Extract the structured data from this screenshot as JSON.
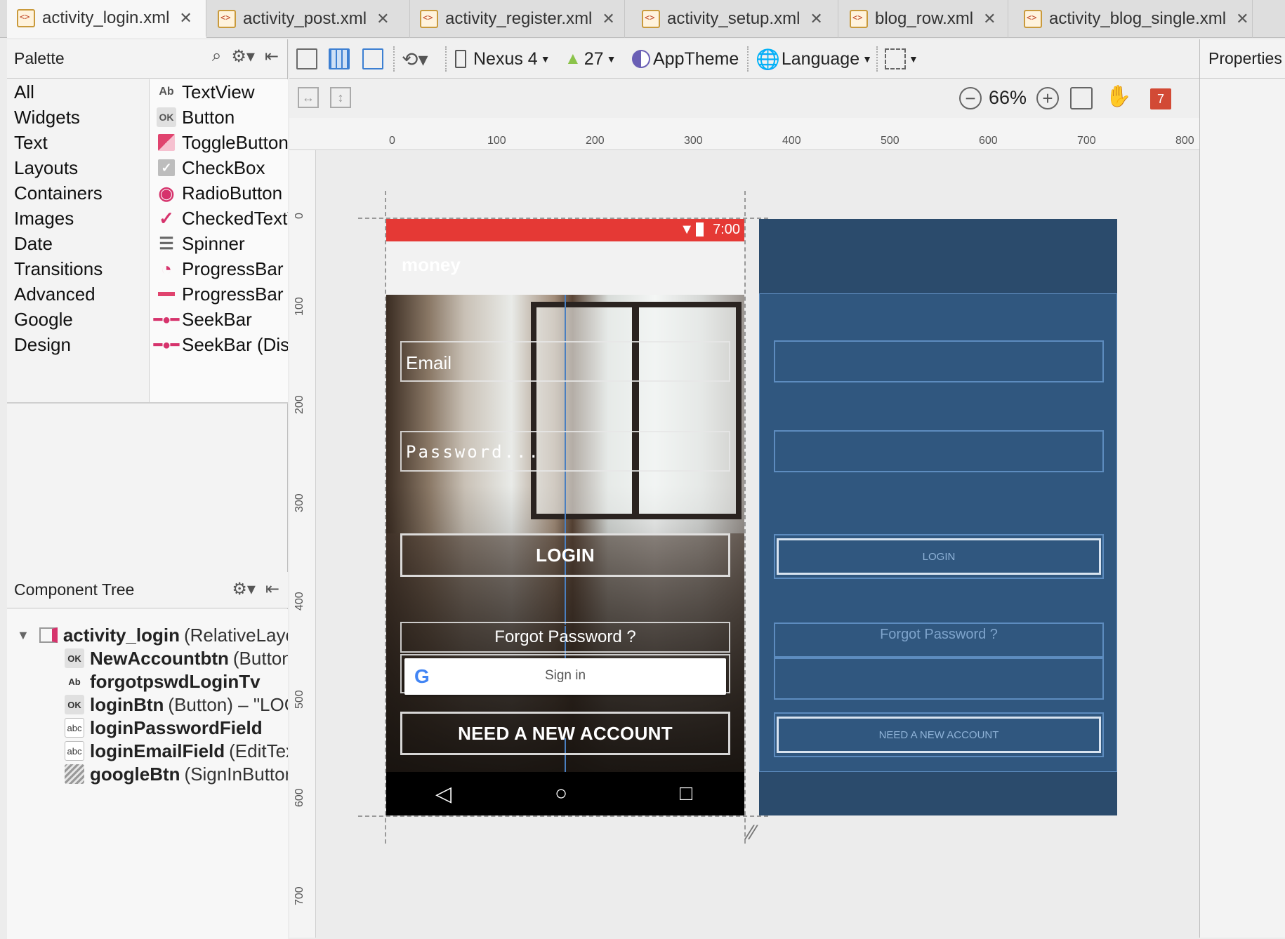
{
  "tabs": [
    {
      "label": "activity_login.xml",
      "active": true
    },
    {
      "label": "activity_post.xml",
      "active": false
    },
    {
      "label": "activity_register.xml",
      "active": false
    },
    {
      "label": "activity_setup.xml",
      "active": false
    },
    {
      "label": "blog_row.xml",
      "active": false
    },
    {
      "label": "activity_blog_single.xml",
      "active": false
    }
  ],
  "palette": {
    "title": "Palette",
    "categories": [
      "All",
      "Widgets",
      "Text",
      "Layouts",
      "Containers",
      "Images",
      "Date",
      "Transitions",
      "Advanced",
      "Google",
      "Design"
    ],
    "widgets": [
      {
        "icon": "Ab",
        "label": "TextView"
      },
      {
        "icon": "OK",
        "label": "Button"
      },
      {
        "icon": "toggle-icon",
        "label": "ToggleButton"
      },
      {
        "icon": "checkbox-icon",
        "label": "CheckBox"
      },
      {
        "icon": "radio-icon",
        "label": "RadioButton"
      },
      {
        "icon": "checked-text-icon",
        "label": "CheckedTextView"
      },
      {
        "icon": "spinner-icon",
        "label": "Spinner"
      },
      {
        "icon": "progress-circle-icon",
        "label": "ProgressBar"
      },
      {
        "icon": "progress-bar-icon",
        "label": "ProgressBar"
      },
      {
        "icon": "seekbar-icon",
        "label": "SeekBar"
      },
      {
        "icon": "seekbar-icon",
        "label": "SeekBar (Discrete)"
      }
    ]
  },
  "component_tree": {
    "title": "Component Tree",
    "nodes": [
      {
        "icon": "layout-icon",
        "id": "activity_login",
        "type": "(RelativeLayout)"
      },
      {
        "icon": "OK",
        "id": "NewAccountbtn",
        "type": "(Button)"
      },
      {
        "icon": "Ab",
        "id": "forgotpswdLoginTv",
        "type": ""
      },
      {
        "icon": "OK",
        "id": "loginBtn",
        "type": "(Button) – \"LOGIN\""
      },
      {
        "icon": "abc",
        "id": "loginPasswordField",
        "type": ""
      },
      {
        "icon": "abc",
        "id": "loginEmailField",
        "type": "(EditText)"
      },
      {
        "icon": "hatch-icon",
        "id": "googleBtn",
        "type": "(SignInButton)"
      }
    ]
  },
  "toolbar": {
    "device": "Nexus 4",
    "api": "27",
    "theme": "AppTheme",
    "language": "Language"
  },
  "zoom": {
    "level": "66%",
    "error_count": "7"
  },
  "properties": {
    "title": "Properties"
  },
  "ruler": {
    "h_ticks": [
      "0",
      "100",
      "200",
      "300",
      "400",
      "500",
      "600",
      "700",
      "800"
    ],
    "v_ticks": [
      "0",
      "100",
      "200",
      "300",
      "400",
      "500",
      "600",
      "700"
    ]
  },
  "phone": {
    "status_time": "7:00",
    "app_title": "money",
    "email_hint": "Email",
    "password_hint": "Password...",
    "login_label": "LOGIN",
    "forgot_label": "Forgot Password ?",
    "google_label": "Sign in",
    "new_account_label": "NEED A NEW ACCOUNT"
  },
  "blueprint": {
    "login_label": "LOGIN",
    "forgot_label": "Forgot Password ?",
    "new_account_label": "NEED A NEW ACCOUNT"
  }
}
